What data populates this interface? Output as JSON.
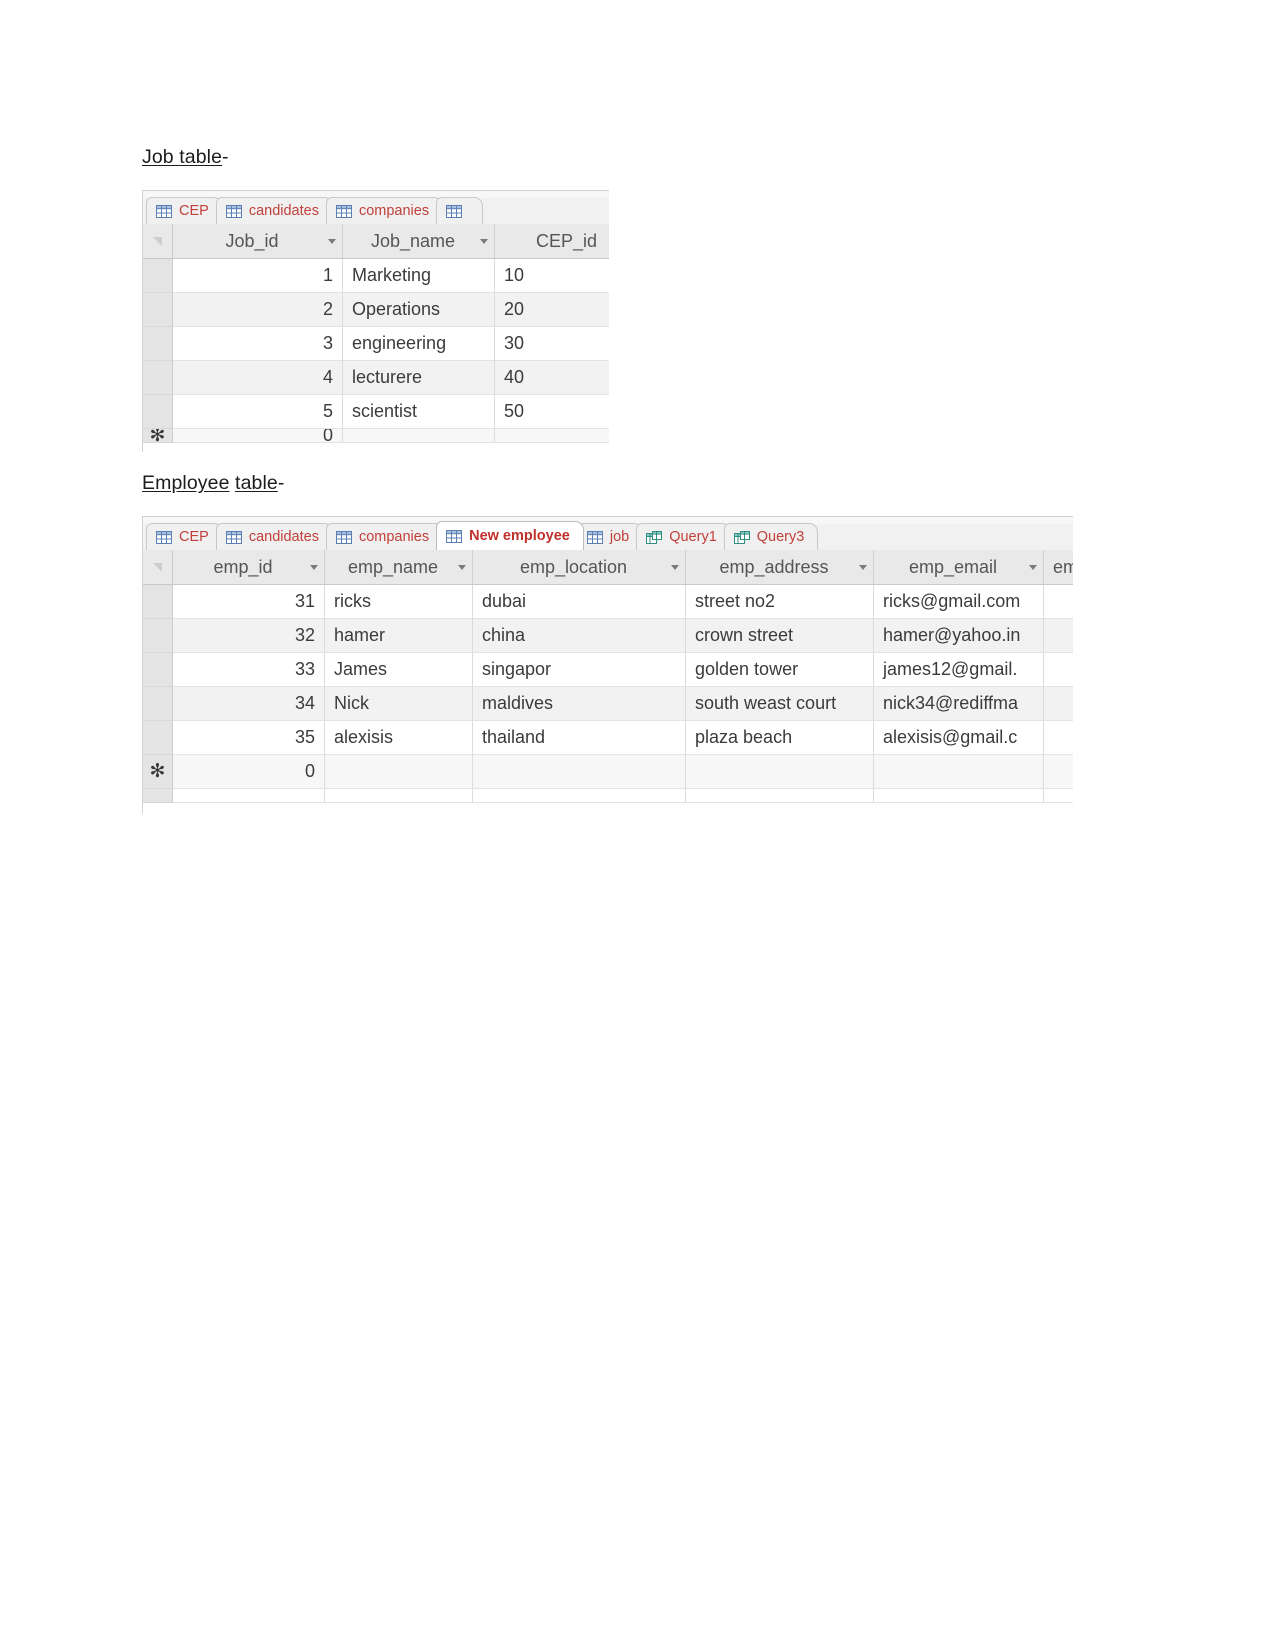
{
  "document": {
    "job_section_heading": "Job table-",
    "job_section_heading_parts": {
      "underlined": "Job table",
      "trailing": "-"
    },
    "employee_section_heading_parts": {
      "word1": "Employee",
      "word2": "table",
      "trailing": "-"
    }
  },
  "job_screenshot": {
    "tabs": [
      {
        "label": "CEP",
        "icon": "table-icon",
        "active": false
      },
      {
        "label": "candidates",
        "icon": "table-icon",
        "active": false
      },
      {
        "label": "companies",
        "icon": "table-icon",
        "active": false
      },
      {
        "label": "",
        "icon": "table-icon",
        "active": false,
        "clipped": true
      }
    ],
    "columns": [
      {
        "label": "Job_id",
        "has_filter_caret": true
      },
      {
        "label": "Job_name",
        "has_filter_caret": true
      },
      {
        "label": "CEP_id",
        "has_filter_caret": false,
        "clipped": true
      }
    ],
    "rows": [
      {
        "Job_id": "1",
        "Job_name": "Marketing",
        "CEP_id": "10"
      },
      {
        "Job_id": "2",
        "Job_name": "Operations",
        "CEP_id": "20"
      },
      {
        "Job_id": "3",
        "Job_name": "engineering",
        "CEP_id": "30"
      },
      {
        "Job_id": "4",
        "Job_name": "lecturere",
        "CEP_id": "40"
      },
      {
        "Job_id": "5",
        "Job_name": "scientist",
        "CEP_id": "50"
      }
    ],
    "new_record_row": {
      "marker": "✻",
      "Job_id": "0",
      "Job_name": "",
      "CEP_id": ""
    }
  },
  "employee_screenshot": {
    "tabs": [
      {
        "label": "CEP",
        "icon": "table-icon",
        "active": false
      },
      {
        "label": "candidates",
        "icon": "table-icon",
        "active": false
      },
      {
        "label": "companies",
        "icon": "table-icon",
        "active": false
      },
      {
        "label": "New employee",
        "icon": "table-icon",
        "active": true
      },
      {
        "label": "job",
        "icon": "table-icon",
        "active": false
      },
      {
        "label": "Query1",
        "icon": "query-icon",
        "active": false
      },
      {
        "label": "Query3",
        "icon": "query-icon",
        "active": false
      }
    ],
    "columns": [
      {
        "label": "emp_id",
        "has_filter_caret": true
      },
      {
        "label": "emp_name",
        "has_filter_caret": true
      },
      {
        "label": "emp_location",
        "has_filter_caret": true
      },
      {
        "label": "emp_address",
        "has_filter_caret": true
      },
      {
        "label": "emp_email",
        "has_filter_caret": true
      },
      {
        "label": "em",
        "has_filter_caret": false,
        "clipped": true
      }
    ],
    "rows": [
      {
        "emp_id": "31",
        "emp_name": "ricks",
        "emp_location": "dubai",
        "emp_address": "street no2",
        "emp_email": "ricks@gmail.com"
      },
      {
        "emp_id": "32",
        "emp_name": "hamer",
        "emp_location": "china",
        "emp_address": "crown street",
        "emp_email": "hamer@yahoo.in"
      },
      {
        "emp_id": "33",
        "emp_name": "James",
        "emp_location": "singapor",
        "emp_address": "golden tower",
        "emp_email": "james12@gmail."
      },
      {
        "emp_id": "34",
        "emp_name": "Nick",
        "emp_location": "maldives",
        "emp_address": "south weast court",
        "emp_email": "nick34@rediffma"
      },
      {
        "emp_id": "35",
        "emp_name": "alexisis",
        "emp_location": "thailand",
        "emp_address": "plaza beach",
        "emp_email": "alexisis@gmail.c"
      }
    ],
    "new_record_row": {
      "marker": "✻",
      "emp_id": "0",
      "emp_name": "",
      "emp_location": "",
      "emp_address": "",
      "emp_email": ""
    }
  },
  "colors": {
    "tab_label": "#c2403a",
    "active_tab_label": "#c0302b",
    "header_bg": "#e9e9e9",
    "alt_row_bg": "#f2f2f2",
    "table_icon": "#5b7fb4",
    "query_icon": "#2f8f82"
  }
}
